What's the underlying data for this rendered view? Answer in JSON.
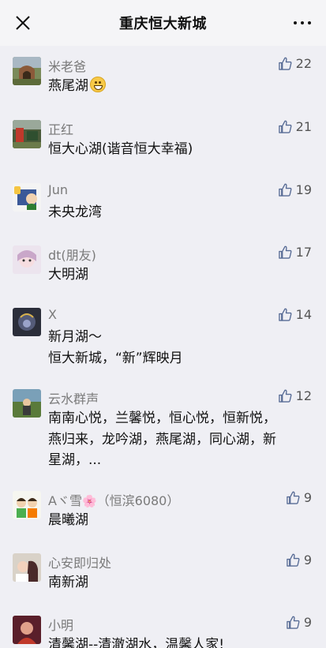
{
  "header": {
    "title": "重庆恒大新城"
  },
  "comments": [
    {
      "name": "米老爸",
      "text": "燕尾湖",
      "likes": "22",
      "has_emoji": true
    },
    {
      "name": "正红",
      "text": "恒大心湖(谐音恒大幸福)",
      "likes": "21"
    },
    {
      "name": "Jun",
      "text": "未央龙湾",
      "likes": "19"
    },
    {
      "name": "dt(朋友)",
      "text": "大明湖",
      "likes": "17"
    },
    {
      "name": "X",
      "text": "新月湖～\n恒大新城，“新”辉映月",
      "likes": "14"
    },
    {
      "name": "云水群声",
      "text": "南南心悦，兰馨悦，恒心悦，恒新悦，\n燕归来，龙吟湖，燕尾湖，同心湖，新\n星湖，...",
      "likes": "12"
    },
    {
      "name_prefix": "Aヾ雪",
      "name_suffix": "（恒滨6080）",
      "text": "晨曦湖",
      "likes": "9"
    },
    {
      "name": "心安即归处",
      "text": "南新湖",
      "likes": "9"
    },
    {
      "name": "小明",
      "text": "清馨湖--清澈湖水，温馨人家!",
      "likes": "9"
    }
  ],
  "colors": {
    "background": "#efeff4",
    "name_text": "#7a7a7a",
    "like_icon": "#576b95"
  },
  "icons": {
    "close": "close-icon",
    "more": "more-icon",
    "like": "thumbs-up-icon"
  }
}
